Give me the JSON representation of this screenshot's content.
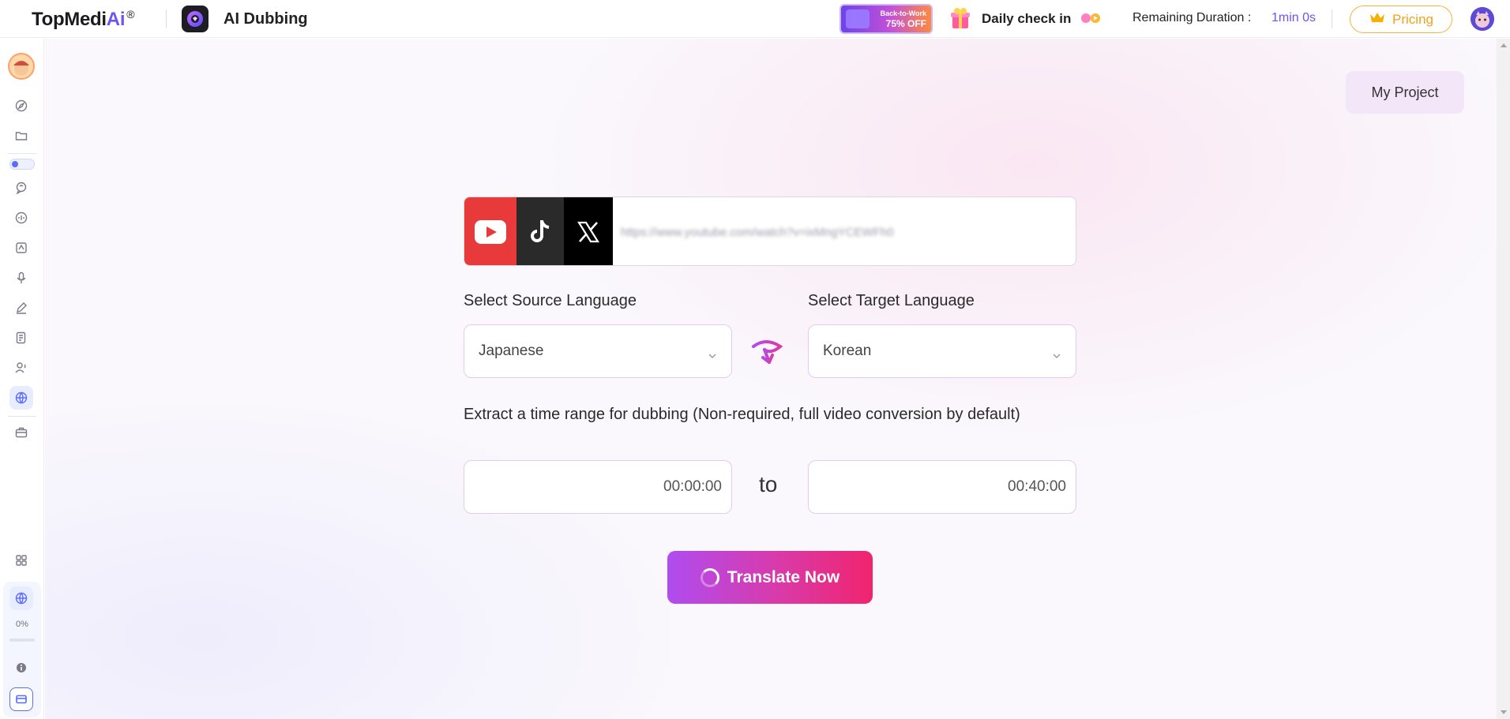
{
  "header": {
    "brand_main": "TopMedi",
    "brand_ai": "Ai",
    "brand_reg": "®",
    "app_name": "AI Dubbing",
    "promo_line1": "Back-to-Work",
    "promo_line2": "75% OFF",
    "checkin_label": "Daily check in",
    "remaining_label": "Remaining Duration :",
    "remaining_value": "1min 0s",
    "pricing_label": "Pricing"
  },
  "sidebar": {
    "items": [
      "compass-icon",
      "folder-icon",
      "toggle",
      "voice-chat-icon",
      "waveform-icon",
      "document-ai-icon",
      "microphone-icon",
      "pen-icon",
      "notes-icon",
      "user-voice-icon",
      "globe-icon",
      "toolbox-icon"
    ],
    "bottom_items": [
      "apps-grid-icon",
      "globe-icon",
      "info-icon",
      "card-icon"
    ],
    "progress_text": "0%",
    "progress_value": 0
  },
  "main": {
    "my_project_label": "My Project",
    "url": {
      "value": "https://www.youtube.com/watch?v=ixMngYCEWFh0"
    },
    "source_label": "Select Source Language",
    "target_label": "Select Target Language",
    "source_value": "Japanese",
    "target_value": "Korean",
    "time_range_label": "Extract a time range for dubbing (Non-required, full video conversion by default)",
    "start_time": "00:00:00",
    "end_time": "00:40:00",
    "to_label": "to",
    "translate_label": "Translate Now"
  },
  "colors": {
    "accent": "#6e54f5",
    "pricing": "#f0a21b",
    "button_gradient_start": "#b04cf0",
    "button_gradient_end": "#f0246e",
    "youtube": "#e83a3a"
  }
}
